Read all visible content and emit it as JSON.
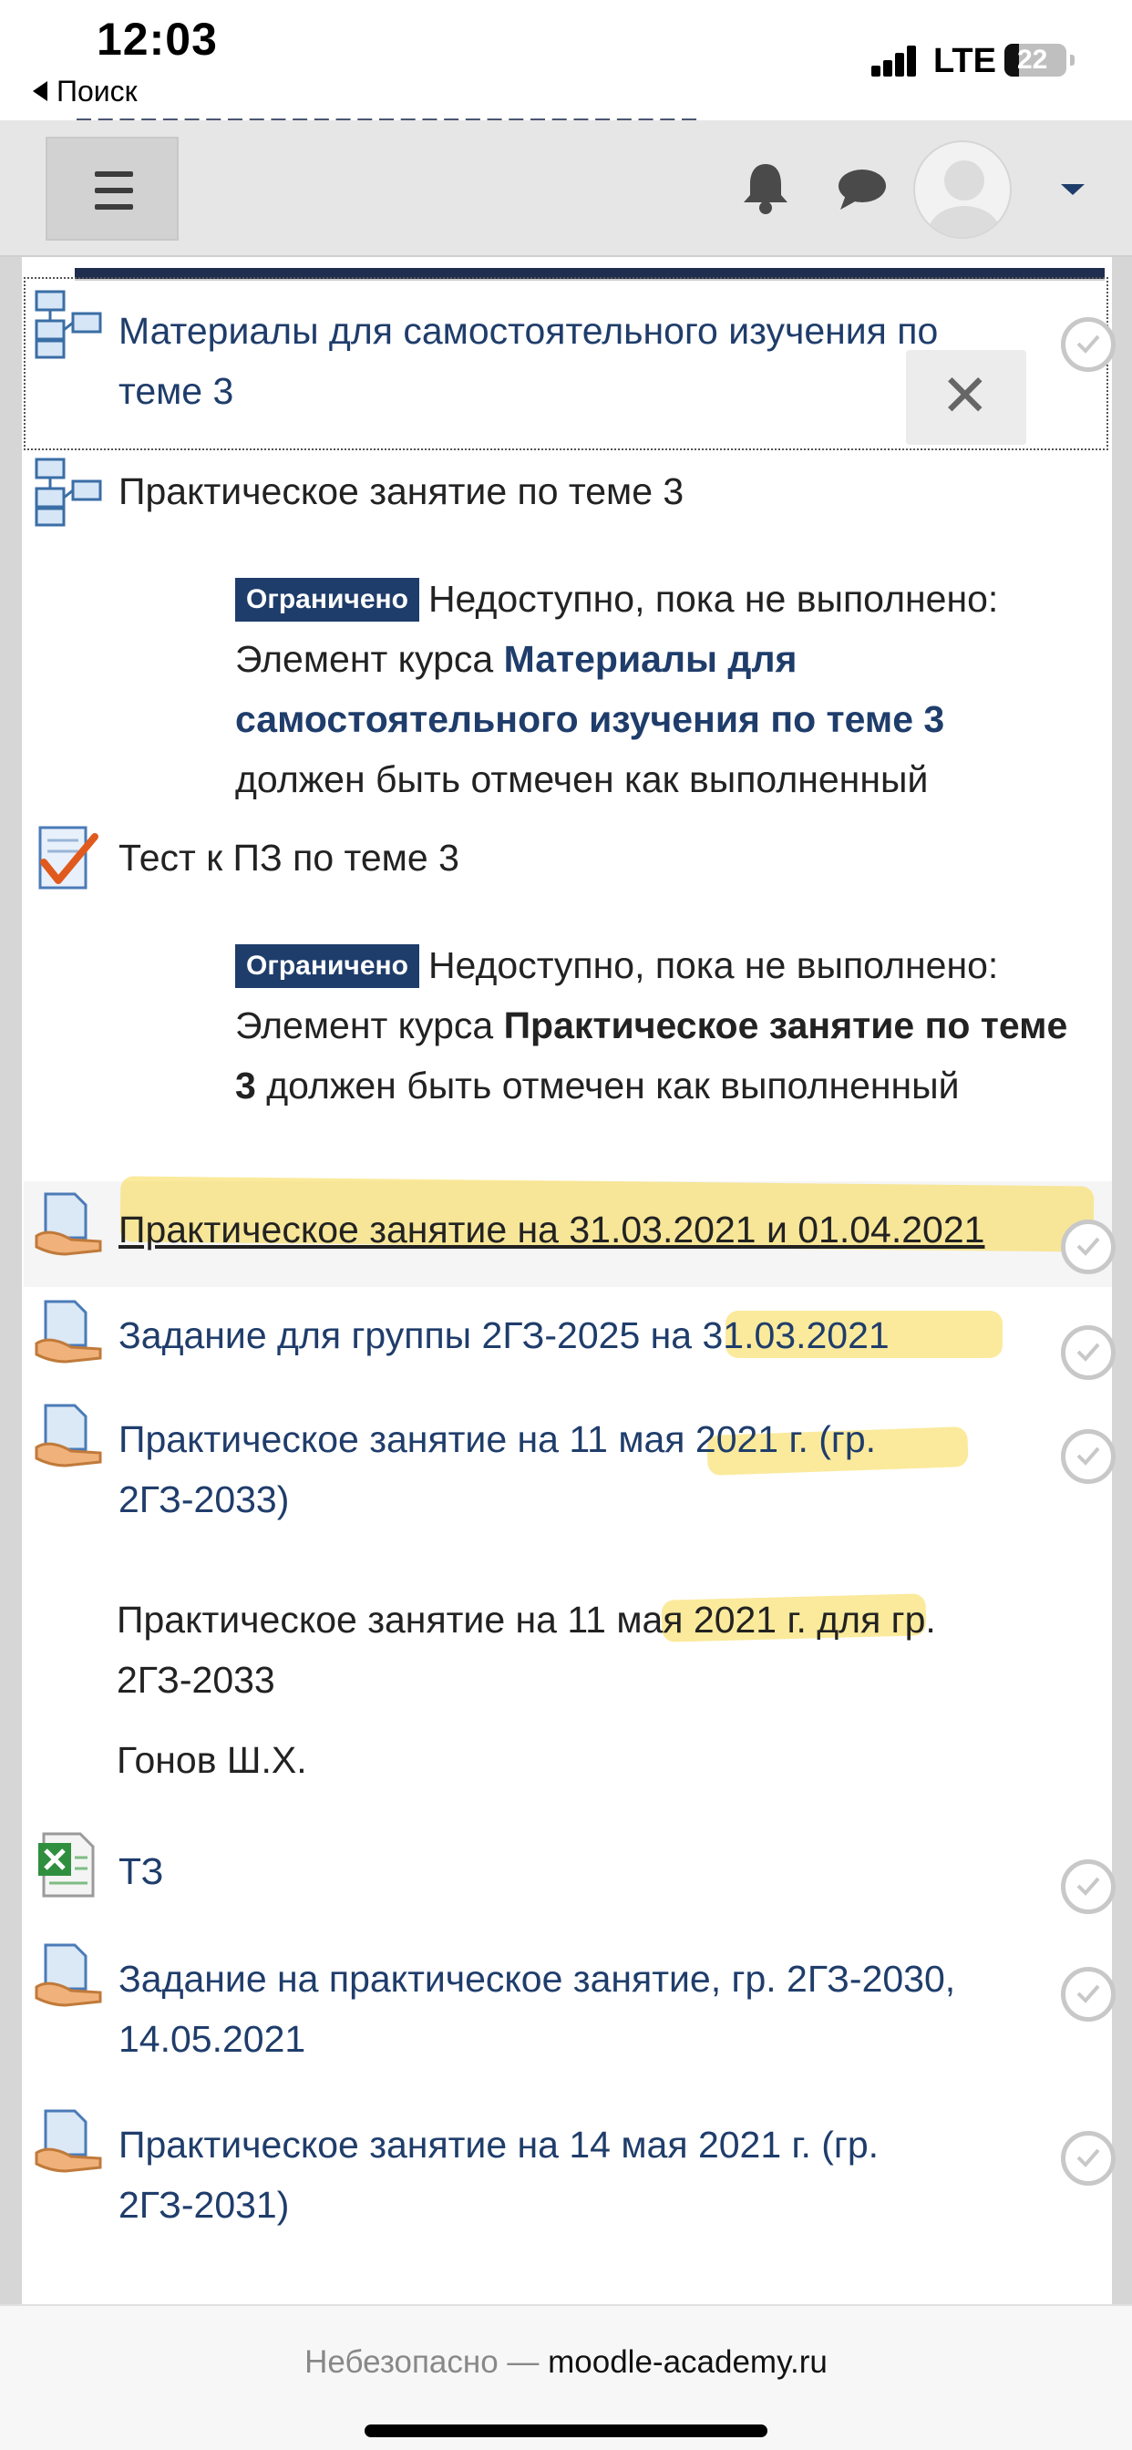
{
  "status_bar": {
    "time": "12:03",
    "back_label": "Поиск",
    "network": "LTE",
    "battery": "22"
  },
  "navbar": {},
  "activities": [
    {
      "title_line1": "Материалы для самостоятельного изучения по",
      "title_line2": "теме 3"
    },
    {
      "title": "Практическое занятие по теме 3",
      "restriction": {
        "badge": "Ограничено",
        "text_before": "Недоступно, пока не выполнено: Элемент курса ",
        "link": "Материалы для самостоятельного изучения по теме 3",
        "text_after": " должен быть отмечен как выполненный"
      }
    },
    {
      "title": "Тест к ПЗ по теме 3",
      "restriction": {
        "badge": "Ограничено",
        "text_before": "Недоступно, пока не выполнено: Элемент курса ",
        "link": "Практическое занятие по теме 3",
        "text_after": " должен быть отмечен как выполненный"
      }
    },
    {
      "title": "Практическое занятие на 31.03.2021 и 01.04.2021"
    },
    {
      "title": "Задание для группы 2ГЗ-2025 на 31.03.2021"
    },
    {
      "title_line1": "Практическое занятие на 11 мая 2021 г. (гр.",
      "title_line2": "2ГЗ-2033)",
      "description_line1": "Практическое занятие на 11 мая 2021 г. для гр.",
      "description_line2": "2ГЗ-2033",
      "description_author": "Гонов Ш.Х."
    },
    {
      "title": "ТЗ"
    },
    {
      "title_line1": "Задание на практическое занятие, гр. 2ГЗ-2030,",
      "title_line2": "14.05.2021"
    },
    {
      "title_line1": "Практическое занятие на 14 мая 2021 г. (гр.",
      "title_line2": "2ГЗ-2031)"
    }
  ],
  "url_bar": {
    "prefix": "Небезопасно — ",
    "host": "moodle-academy.ru"
  },
  "colors": {
    "link": "#1f3d6b",
    "badge_bg": "#1f3d6b",
    "highlight": "#f7d84a",
    "navbar_bg": "#e6e6e6"
  }
}
